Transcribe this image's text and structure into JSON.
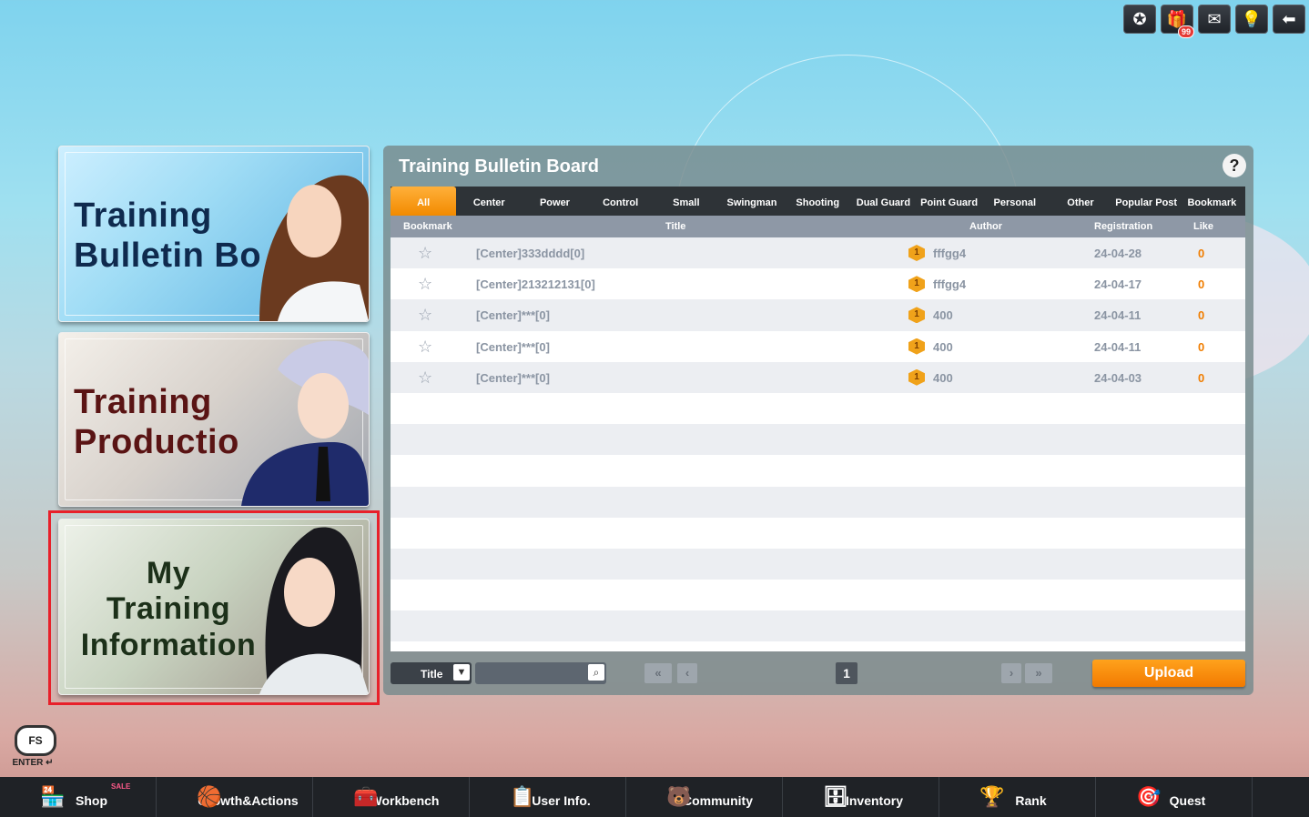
{
  "top_icons": [
    {
      "name": "achievement-icon",
      "glyph": "✪"
    },
    {
      "name": "gift-icon",
      "glyph": "🎁",
      "badge": "99"
    },
    {
      "name": "mail-icon",
      "glyph": "✉"
    },
    {
      "name": "tip-icon",
      "glyph": "💡"
    },
    {
      "name": "back-icon",
      "glyph": "⬅"
    }
  ],
  "cards": {
    "bulletin": {
      "line1": "Training",
      "line2": "Bulletin Bo"
    },
    "production": {
      "line1": "Training",
      "line2": "Productio"
    },
    "my_info": {
      "line1": "My",
      "line2": "Training",
      "line3": "Information"
    }
  },
  "panel": {
    "title": "Training Bulletin Board",
    "help": "?",
    "tabs": [
      "All",
      "Center",
      "Power",
      "Control",
      "Small",
      "Swingman",
      "Shooting",
      "Dual Guard",
      "Point Guard",
      "Personal",
      "Other",
      "Popular Post",
      "Bookmark"
    ],
    "active_tab": "All",
    "columns": {
      "bookmark": "Bookmark",
      "title": "Title",
      "author": "Author",
      "registration": "Registration",
      "like": "Like"
    },
    "rows": [
      {
        "title": "[Center]333dddd[0]",
        "level": "1",
        "author": "fffgg4",
        "date": "24-04-28",
        "like": "0"
      },
      {
        "title": "[Center]213212131[0]",
        "level": "1",
        "author": "fffgg4",
        "date": "24-04-17",
        "like": "0"
      },
      {
        "title": "[Center]***[0]",
        "level": "1",
        "author": "400",
        "date": "24-04-11",
        "like": "0"
      },
      {
        "title": "[Center]***[0]",
        "level": "1",
        "author": "400",
        "date": "24-04-11",
        "like": "0"
      },
      {
        "title": "[Center]***[0]",
        "level": "1",
        "author": "400",
        "date": "24-04-03",
        "like": "0"
      }
    ],
    "search_filter": "Title",
    "search_value": "",
    "page": "1",
    "upload_label": "Upload"
  },
  "chat": {
    "logo": "FS",
    "enter": "ENTER ↵"
  },
  "nav": [
    {
      "label": "Shop",
      "icon": "🏪",
      "sale": "SALE"
    },
    {
      "label": "Growth&Actions",
      "icon": "🏀"
    },
    {
      "label": "Workbench",
      "icon": "🧰"
    },
    {
      "label": "User Info.",
      "icon": "📋"
    },
    {
      "label": "Community",
      "icon": "🐻"
    },
    {
      "label": "Inventory",
      "icon": "🗄"
    },
    {
      "label": "Rank",
      "icon": "🏆"
    },
    {
      "label": "Quest",
      "icon": "🎯"
    }
  ]
}
